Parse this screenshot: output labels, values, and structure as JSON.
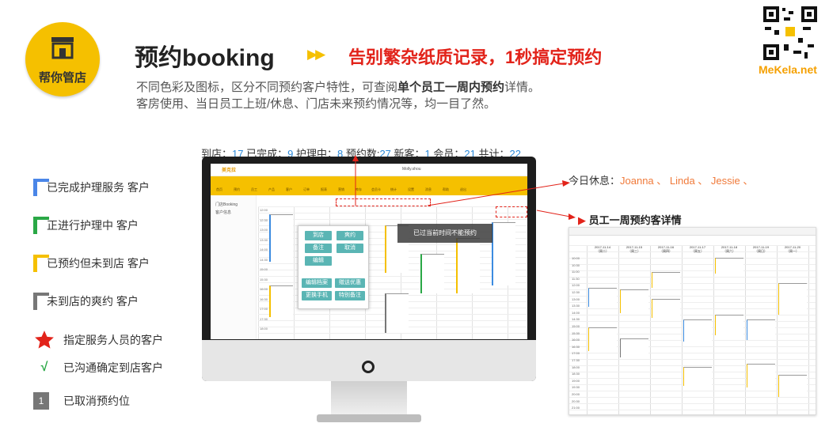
{
  "brand": {
    "name": "帮你管店",
    "site": "MeKela.net"
  },
  "header": {
    "title": "预约booking",
    "arrows": "▶▶",
    "slogan": "告别繁杂纸质记录，1秒搞定预约",
    "sub1_a": "不同色彩及图标，区分不同预约客户特性，可查阅",
    "sub1_b": "单个员工一周内预约",
    "sub1_c": "详情。",
    "sub2": "客房使用、当日员工上班/休息、门店未来预约情况等，均一目了然。"
  },
  "stats": [
    {
      "label": "到店：",
      "value": "17"
    },
    {
      "label": " 已完成：",
      "value": "9"
    },
    {
      "label": " 护理中：",
      "value": "8"
    },
    {
      "label": " 预约数:",
      "value": "27"
    },
    {
      "label": " 新客：",
      "value": "1"
    },
    {
      "label": " 会员：",
      "value": "21"
    },
    {
      "label": " 共计：",
      "value": "22"
    }
  ],
  "legend": [
    {
      "label": "已完成护理服务 客户",
      "color": "#4a86e8"
    },
    {
      "label": "正进行护理中 客户",
      "color": "#2aa846"
    },
    {
      "label": "已预约但未到店 客户",
      "color": "#f5c000"
    },
    {
      "label": "未到店的爽约 客户",
      "color": "#777777"
    }
  ],
  "legend_icons": [
    {
      "icon": "star-icon",
      "label": "指定服务人员的客户"
    },
    {
      "icon": "check-icon",
      "symbol": "√",
      "label": "已沟通确定到店客户"
    },
    {
      "icon": "number-icon",
      "symbol": "1",
      "label": "已取消预约位"
    }
  ],
  "screen": {
    "app_name": "美克拉",
    "user": "Molly.shou",
    "nav": [
      "首页",
      "预约",
      "员工",
      "产品",
      "客户",
      "订单",
      "报表",
      "营销",
      "库存",
      "会员卡",
      "统计",
      "设置",
      "消息",
      "帮助",
      "退出"
    ],
    "side": [
      "门店Booking",
      "客户信息"
    ],
    "popup": {
      "btn1": "到店",
      "btn2": "爽约",
      "btn3": "备注",
      "btn4": "取消",
      "btn5": "编辑",
      "btn6": "编辑档案",
      "btn7": "赠送优惠",
      "btn8": "更换手机",
      "btn9": "特别备注"
    },
    "toast": "已过当前时间不能预约",
    "times": [
      "12:00",
      "12:30",
      "13:00",
      "13:30",
      "14:00",
      "14:30",
      "15:00",
      "15:30",
      "16:00",
      "16:30",
      "17:00",
      "17:30",
      "18:00"
    ]
  },
  "today_off": {
    "label": "今日休息：",
    "names": "Joanna 、 Linda 、 Jessie 、"
  },
  "week": {
    "title": "员工一周预约客详情",
    "days": [
      {
        "date": "2017-11-14",
        "wk": "（周二）"
      },
      {
        "date": "2017-11-15",
        "wk": "（周三）"
      },
      {
        "date": "2017-11-16",
        "wk": "（周四）"
      },
      {
        "date": "2017-11-17",
        "wk": "（周五）"
      },
      {
        "date": "2017-11-18",
        "wk": "（周六）"
      },
      {
        "date": "2017-11-19",
        "wk": "（周日）"
      },
      {
        "date": "2017-11-20",
        "wk": "（周一）"
      }
    ],
    "times": [
      "10:00",
      "10:30",
      "11:00",
      "11:30",
      "12:00",
      "12:30",
      "13:00",
      "13:30",
      "14:00",
      "14:30",
      "15:00",
      "15:30",
      "16:00",
      "16:30",
      "17:00",
      "17:30",
      "18:00",
      "18:30",
      "19:00",
      "19:30",
      "20:00",
      "20:30",
      "21:00"
    ]
  }
}
